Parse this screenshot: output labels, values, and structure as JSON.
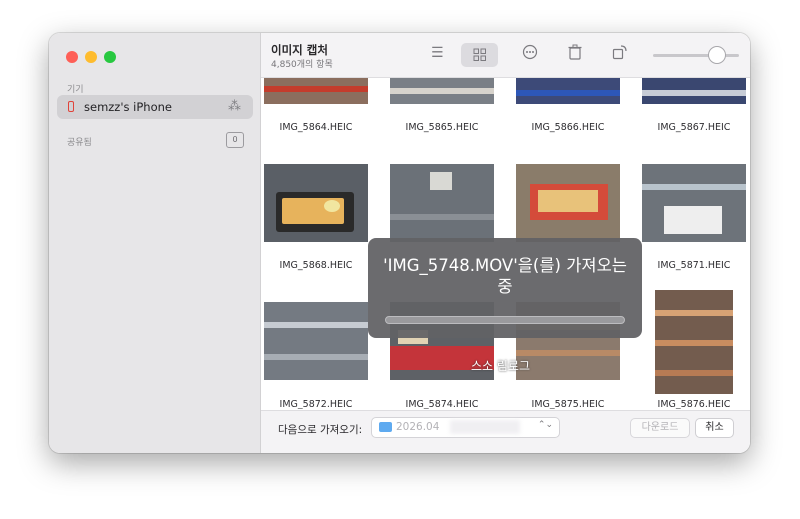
{
  "app": {
    "title": "이미지 캡처",
    "count_text": "4,850개의 항목"
  },
  "sidebar": {
    "devices_header": "기기",
    "device_name": "semzz's iPhone",
    "shared_header": "공유됨",
    "shared_count": "0"
  },
  "photos": [
    {
      "name": "IMG_5864.HEIC"
    },
    {
      "name": "IMG_5865.HEIC"
    },
    {
      "name": "IMG_5866.HEIC"
    },
    {
      "name": "IMG_5867.HEIC"
    },
    {
      "name": "IMG_5868.HEIC"
    },
    {
      "name": ""
    },
    {
      "name": ""
    },
    {
      "name": "IMG_5871.HEIC"
    },
    {
      "name": "IMG_5872.HEIC"
    },
    {
      "name": "IMG_5874.HEIC"
    },
    {
      "name": "IMG_5875.HEIC"
    },
    {
      "name": "IMG_5876.HEIC"
    }
  ],
  "bottom": {
    "import_to_label": "다음으로 가져오기:",
    "destination": "2026.04",
    "download_label": "다운로드",
    "cancel_label": "취소"
  },
  "progress": {
    "message": "'IMG_5748.MOV'을(를) 가져오는 중",
    "fraction": 0.0
  },
  "overlay_text": "스소 림로그",
  "colors": {
    "accent": "#0a84ff",
    "close": "#fe5f57",
    "minimize": "#febc2e",
    "zoom": "#28c840"
  }
}
